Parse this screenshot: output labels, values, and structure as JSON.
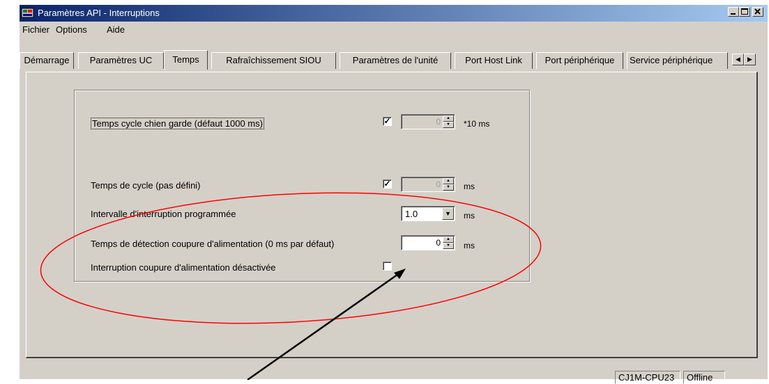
{
  "window": {
    "title": "Paramètres API - Interruptions",
    "app_icon": "plc-icon",
    "minimize_icon": "minimize-icon",
    "maximize_icon": "maximize-icon",
    "close_icon": "close-icon"
  },
  "menu": [
    "Fichier",
    "Options",
    "Aide"
  ],
  "tabs": [
    {
      "label": "Démarrage"
    },
    {
      "label": "Paramètres UC"
    },
    {
      "label": "Temps",
      "active": true
    },
    {
      "label": "Rafraîchissement SIOU"
    },
    {
      "label": "Paramètres de l'unité"
    },
    {
      "label": "Port Host Link"
    },
    {
      "label": "Port périphérique"
    },
    {
      "label": "Service périphérique"
    }
  ],
  "tab_scroll": {
    "left_icon": "arrow-left-icon",
    "right_icon": "arrow-right-icon"
  },
  "settings": {
    "watchdog": {
      "label": "Temps cycle chien garde (défaut 1000 ms)",
      "checked": true,
      "value": "0",
      "unit": "*10 ms"
    },
    "cycle_time": {
      "label": "Temps de cycle (pas défini)",
      "checked": true,
      "value": "0",
      "unit": "ms"
    },
    "scheduled_interrupt": {
      "label": "Intervalle d'interruption programmée",
      "value": "1.0",
      "unit": "ms"
    },
    "power_detection": {
      "label": "Temps de détection coupure d'alimentation (0 ms par défaut)",
      "value": "0",
      "unit": "ms"
    },
    "power_interrupt_disabled": {
      "label": "Interruption coupure d'alimentation désactivée",
      "checked": false
    }
  },
  "status": {
    "model": "CJ1M-CPU23",
    "mode": "Offline"
  },
  "annotation": {
    "ellipse_color": "#ff0000",
    "arrow_color": "#000000"
  }
}
